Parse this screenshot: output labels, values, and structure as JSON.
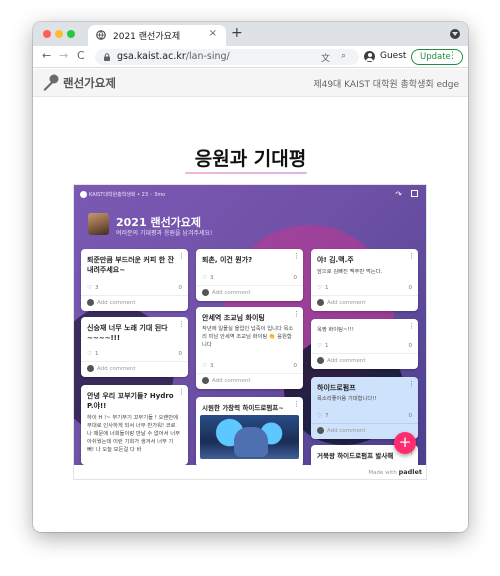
{
  "browser": {
    "tab_title": "2021 랜선가요제",
    "tab_close": "×",
    "new_tab": "+",
    "back": "←",
    "forward": "→",
    "reload": "C",
    "url_host": "gsa.kaist.ac.kr",
    "url_path": "/lan-sing/",
    "translate_icon": "文",
    "zoom_icon": "⌕",
    "profile_label": "Guest",
    "update_label": "Update",
    "menu_icon": "⋮"
  },
  "site": {
    "title": "랜선가요제",
    "subtitle": "제49대 KAIST 대학원 총학생회 edge"
  },
  "main": {
    "heading": "응원과 기대평"
  },
  "padlet": {
    "top_bar": "KAIST대학원총학생회 • 23 ◦ 3mo",
    "share_icon": "↷",
    "title": "2021 랜선가요제",
    "description": "여러분의 기대평과 응원을 남겨주세요!",
    "made_with": "Made with",
    "brand": "padlet",
    "fab": "+",
    "add_comment": "Add comment",
    "cards": [
      {
        "title": "퇴준만큼 부드러운 커피 한 잔 내려주세요~",
        "body": "",
        "likes": "3",
        "comments": "0"
      },
      {
        "title": "신승재 너무 노래 기대 된다 ~~~~!!!",
        "body": "",
        "likes": "1",
        "comments": "0"
      },
      {
        "title": "안녕 우리 꼬부기들? Hydro P.야!!",
        "body": "하이 H !~ 부기부기 꼬부기들 ! 오랜만에 무대로 인사하게 되서 너무 반가워! 코로나 때문에 너희들이랑 만날 수 없어서 너무 아쉬웠는데 이런 기회가 생겨서 너무 기뻐! 나 오늘 모든걸 다 바",
        "likes": "",
        "comments": ""
      },
      {
        "title": "퇴촌, 이건 뭔가?",
        "body": "",
        "likes": "3",
        "comments": "0"
      },
      {
        "title": "안세역 조교님 화이팅",
        "body": "작년에 일몰실 올업인 넙죽이 입니다 목소리 미남 안세역 조교님 화이팅 👏 응원합니다",
        "likes": "3",
        "comments": "0"
      },
      {
        "title": "시원한 가창력 하이드로펌프~",
        "body": "",
        "likes": "",
        "comments": ""
      },
      {
        "title": "야! 김.맥.주",
        "body": "앞으로 김빠진 맥주만 먹는다.",
        "likes": "1",
        "comments": "0"
      },
      {
        "title": "",
        "body": "옥짱 화이팅~!!!",
        "likes": "1",
        "comments": "0"
      },
      {
        "title": "하이드로펌프",
        "body": "목소리좋아용 기대합니다!!",
        "likes": "7",
        "comments": "0"
      },
      {
        "title": "거북왕 하이드로펌프 발사해",
        "body": "",
        "likes": "",
        "comments": ""
      }
    ]
  }
}
